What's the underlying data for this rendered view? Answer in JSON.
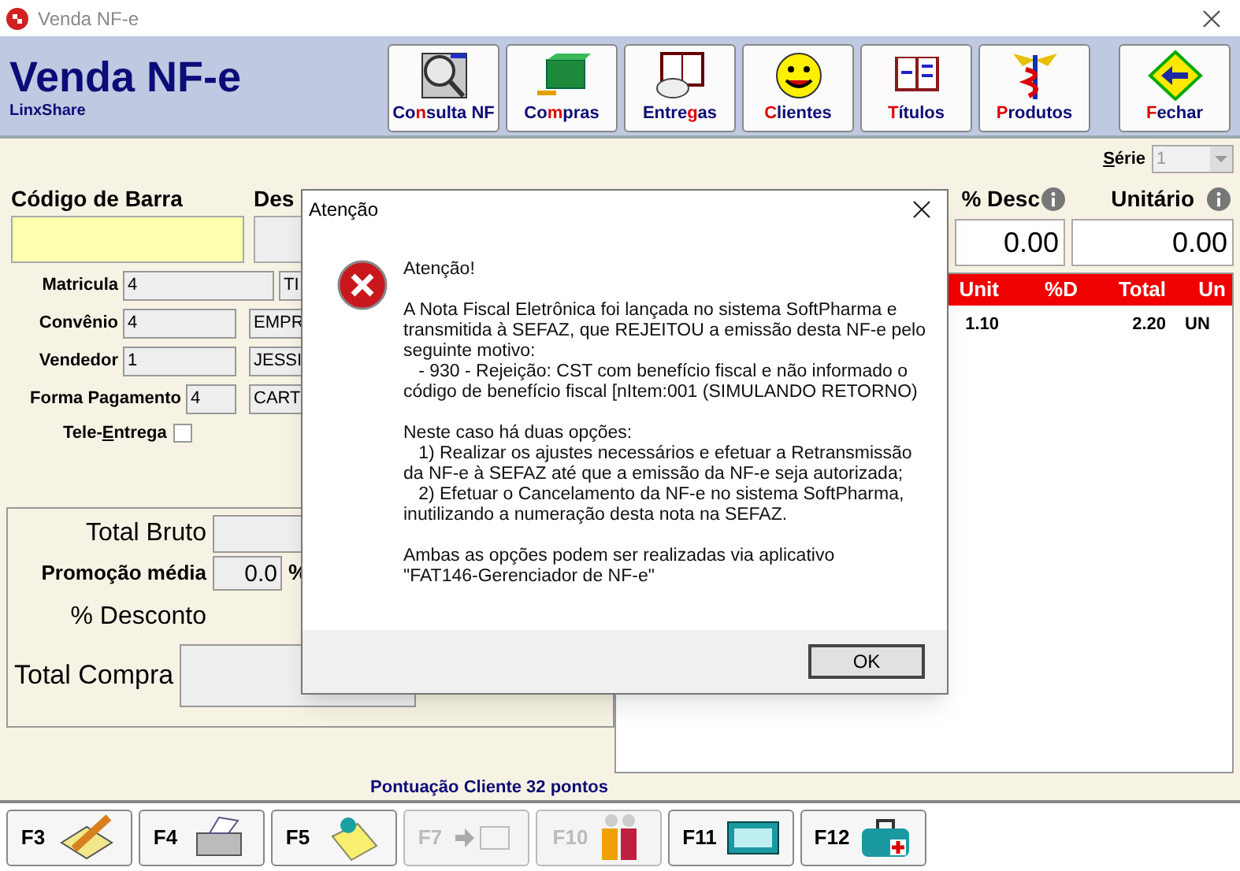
{
  "window": {
    "title": "Venda NF-e"
  },
  "header": {
    "title": "Venda NF-e",
    "subtitle": "LinxShare"
  },
  "toolbar": [
    {
      "pre": "Co",
      "key": "n",
      "post": "sulta NF"
    },
    {
      "pre": "Co",
      "key": "m",
      "post": "pras"
    },
    {
      "pre": "Entre",
      "key": "g",
      "post": "as"
    },
    {
      "key": "C",
      "post": "lientes"
    },
    {
      "key": "T",
      "post": "ítulos"
    },
    {
      "key": "P",
      "post": "rodutos"
    },
    {
      "key": "F",
      "post": "echar"
    }
  ],
  "serie": {
    "key": "S",
    "label": "érie",
    "value": "1",
    "disabled": true
  },
  "form": {
    "barcode_label": "Código de Barra",
    "description_label": "Des",
    "rows": [
      {
        "label": "Matricula",
        "code": "4",
        "name": "TI"
      },
      {
        "label": "Convênio",
        "code": "4",
        "name": "EMPR"
      },
      {
        "label": "Vendedor",
        "code": "1",
        "name": "JESSI"
      },
      {
        "label": "Forma Pagamento",
        "code": "4",
        "name": "CART"
      }
    ],
    "tele_entrega": {
      "pre": "Tele-",
      "key": "E",
      "post": "ntrega",
      "checked": false
    }
  },
  "discount": {
    "label": "% Desc",
    "value": "0.00"
  },
  "unit_price": {
    "label": "Unitário",
    "value": "0.00"
  },
  "table": {
    "columns": [
      "Unit",
      "%D",
      "Total",
      "Un"
    ],
    "rows": [
      [
        "1.10",
        null,
        "2.20",
        "UN"
      ]
    ]
  },
  "totals": {
    "gross_label": "Total Bruto",
    "promo_label": "Promoção média",
    "promo_value": "0.0",
    "promo_unit": "%",
    "discount_label": "% Desconto",
    "total_label": "Total Compra"
  },
  "points": "Pontuação Cliente 32 pontos",
  "function_keys": [
    {
      "label": "F3",
      "disabled": false
    },
    {
      "label": "F4",
      "disabled": false
    },
    {
      "label": "F5",
      "disabled": false
    },
    {
      "label": "F7",
      "disabled": true
    },
    {
      "label": "F10",
      "disabled": true
    },
    {
      "label": "F11",
      "disabled": false
    },
    {
      "label": "F12",
      "disabled": false
    }
  ],
  "dialog": {
    "title": "Atenção",
    "heading": "Atenção!",
    "paragraphs": [
      "A Nota Fiscal Eletrônica foi lançada no sistema SoftPharma e\ntransmitida à SEFAZ, que REJEITOU a emissão desta NF-e pelo\nseguinte motivo:\n   - 930 - Rejeição: CST com benefício fiscal e não informado o\ncódigo de benefício fiscal [nItem:001 (SIMULANDO RETORNO)",
      "Neste caso há duas opções:\n   1) Realizar os ajustes necessários e efetuar a Retransmissão\nda NF-e à SEFAZ até que a emissão da NF-e seja autorizada;\n   2) Efetuar o Cancelamento da NF-e no sistema SoftPharma,\ninutilizando a numeração desta nota na SEFAZ.",
      "Ambas as opções podem ser realizadas via aplicativo\n\"FAT146-Gerenciador de NF-e\""
    ],
    "button": "OK"
  }
}
